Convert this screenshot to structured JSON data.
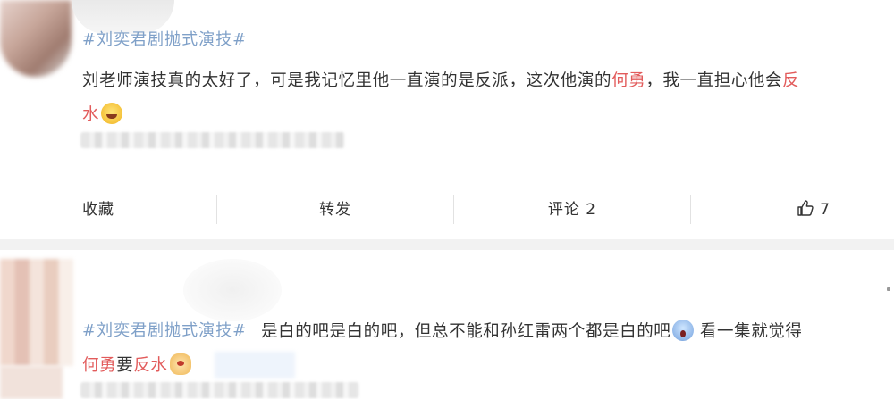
{
  "post1": {
    "hashtag": "#刘奕君剧抛式演技#",
    "text_line1_a": "刘老师演技真的太好了，可是我记忆里他一直演的是反派，这次他演的",
    "text_line1_name": "何勇",
    "text_line1_b": "，我一直担心他会",
    "text_line1_tail": "反",
    "text_line2_red": "水",
    "emoji": "laugh-cry-emoji"
  },
  "actions": {
    "favorite": "收藏",
    "repost": "转发",
    "comment": "评论 2",
    "like_count": "7"
  },
  "post2": {
    "hashtag": "#刘奕君剧抛式演技#",
    "text_line1": "是白的吧是白的吧，但总不能和孙红雷两个都是白的吧",
    "text_line1_after_emoji": "看一集就觉得",
    "line2_name": "何勇",
    "line2_mid": "要",
    "line2_red": "反水",
    "emoji1": "shocked-emoji",
    "emoji2": "dog-emoji"
  },
  "colors": {
    "hashtag": "#7fa0c8",
    "highlight": "#e25b5b",
    "text": "#333333",
    "separator": "#f2f2f2"
  }
}
